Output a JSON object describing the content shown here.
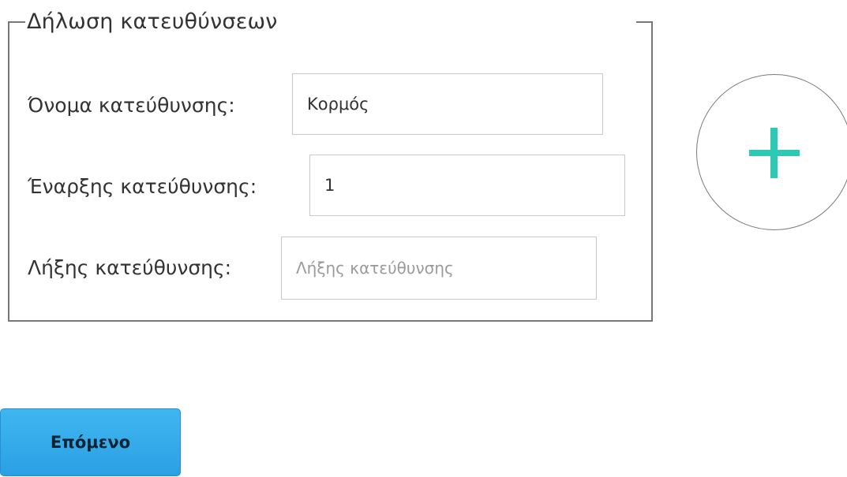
{
  "form": {
    "legend": "Δήλωση κατευθύνσεων",
    "fields": [
      {
        "label": "Όνομα κατεύθυνσης:",
        "value": "Κορμός",
        "placeholder": ""
      },
      {
        "label": "Έναρξης κατεύθυνσης:",
        "value": "1",
        "placeholder": ""
      },
      {
        "label": "Λήξης κατεύθυνσης:",
        "value": "",
        "placeholder": "Λήξης κατεύθυνσης"
      }
    ]
  },
  "add_button": {
    "icon": "plus-icon",
    "color": "#2ec9b4"
  },
  "next_button": {
    "label": "Επόμενο",
    "color": "#35aaea"
  }
}
